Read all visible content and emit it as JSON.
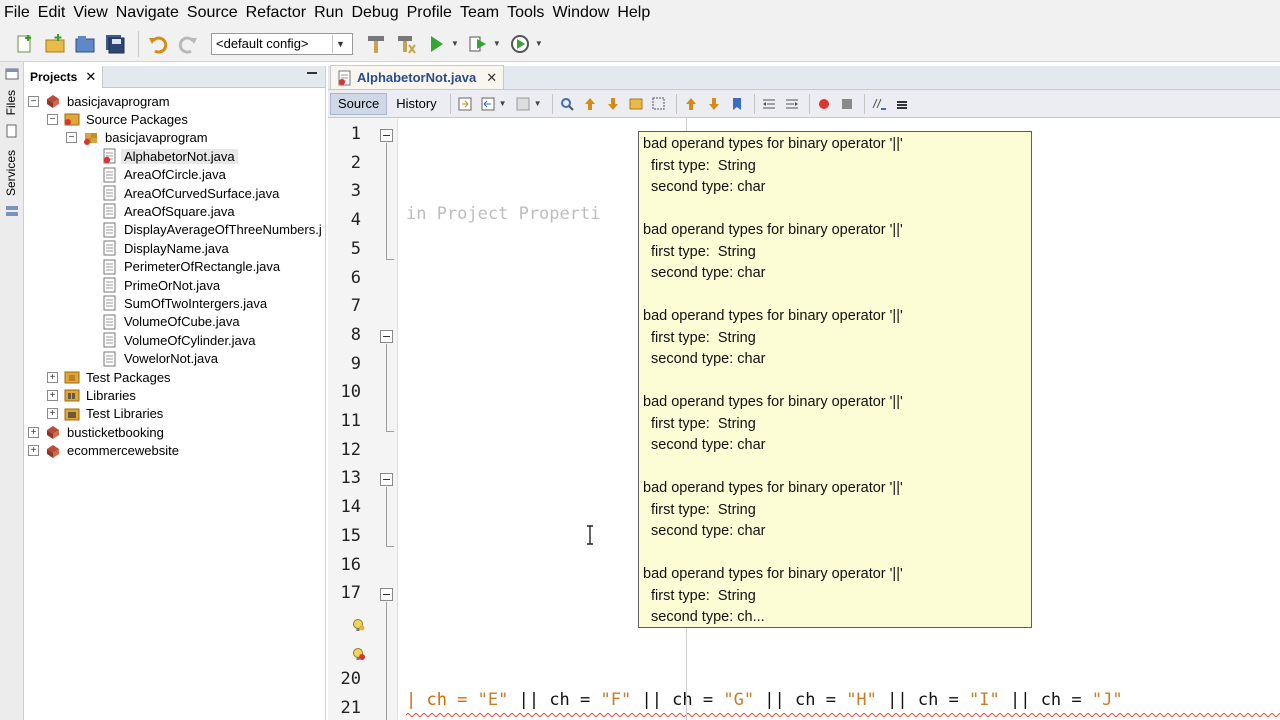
{
  "menu": [
    "File",
    "Edit",
    "View",
    "Navigate",
    "Source",
    "Refactor",
    "Run",
    "Debug",
    "Profile",
    "Team",
    "Tools",
    "Window",
    "Help"
  ],
  "toolbar": {
    "config_value": "<default config>"
  },
  "side_strip": {
    "files_label": "Files",
    "services_label": "Services"
  },
  "projects": {
    "tab_label": "Projects",
    "tree": [
      {
        "label": "basicjavaprogram",
        "depth": 0,
        "expander": "−",
        "icon": "project-icon"
      },
      {
        "label": "Source Packages",
        "depth": 1,
        "expander": "−",
        "icon": "source-packages-icon"
      },
      {
        "label": "basicjavaprogram",
        "depth": 2,
        "expander": "−",
        "icon": "package-icon"
      },
      {
        "label": "AlphabetorNot.java",
        "depth": 3,
        "icon": "java-file-error-icon",
        "selected": true
      },
      {
        "label": "AreaOfCircle.java",
        "depth": 3,
        "icon": "java-file-icon"
      },
      {
        "label": "AreaOfCurvedSurface.java",
        "depth": 3,
        "icon": "java-file-icon"
      },
      {
        "label": "AreaOfSquare.java",
        "depth": 3,
        "icon": "java-file-icon"
      },
      {
        "label": "DisplayAverageOfThreeNumbers.j",
        "depth": 3,
        "icon": "java-file-icon"
      },
      {
        "label": "DisplayName.java",
        "depth": 3,
        "icon": "java-file-icon"
      },
      {
        "label": "PerimeterOfRectangle.java",
        "depth": 3,
        "icon": "java-file-icon"
      },
      {
        "label": "PrimeOrNot.java",
        "depth": 3,
        "icon": "java-file-icon"
      },
      {
        "label": "SumOfTwoIntergers.java",
        "depth": 3,
        "icon": "java-file-icon"
      },
      {
        "label": "VolumeOfCube.java",
        "depth": 3,
        "icon": "java-file-icon"
      },
      {
        "label": "VolumeOfCylinder.java",
        "depth": 3,
        "icon": "java-file-icon"
      },
      {
        "label": "VowelorNot.java",
        "depth": 3,
        "icon": "java-file-icon"
      },
      {
        "label": "Test Packages",
        "depth": 1,
        "expander": "+",
        "icon": "test-packages-icon"
      },
      {
        "label": "Libraries",
        "depth": 1,
        "expander": "+",
        "icon": "libraries-icon"
      },
      {
        "label": "Test Libraries",
        "depth": 1,
        "expander": "+",
        "icon": "test-libraries-icon"
      },
      {
        "label": "busticketbooking",
        "depth": 0,
        "expander": "+",
        "icon": "project-icon"
      },
      {
        "label": "ecommercewebsite",
        "depth": 0,
        "expander": "+",
        "icon": "project-icon"
      }
    ]
  },
  "editor": {
    "file_tab": "AlphabetorNot.java",
    "source_tab": "Source",
    "history_tab": "History",
    "line_numbers": [
      "1",
      "2",
      "3",
      "4",
      "5",
      "6",
      "7",
      "8",
      "9",
      "10",
      "11",
      "12",
      "13",
      "14",
      "15",
      "16",
      "17",
      "20",
      "21"
    ],
    "ghost_text": "in Project Properti",
    "code_line": {
      "prefix": "| ch = ",
      "parts": [
        {
          "str": "\"E\"",
          "sep": " || ch = "
        },
        {
          "str": "\"F\"",
          "sep": " || ch = "
        },
        {
          "str": "\"G\"",
          "sep": " || ch = "
        },
        {
          "str": "\"H\"",
          "sep": " || ch = "
        },
        {
          "str": "\"I\"",
          "sep": " || ch = "
        },
        {
          "str": "\"J\"",
          "sep": ""
        }
      ]
    }
  },
  "tooltip": {
    "blocks": [
      {
        "title": "bad operand types for binary operator '||'",
        "first": "first type:  String",
        "second": "second type: char"
      },
      {
        "title": "bad operand types for binary operator '||'",
        "first": "first type:  String",
        "second": "second type: char"
      },
      {
        "title": "bad operand types for binary operator '||'",
        "first": "first type:  String",
        "second": "second type: char"
      },
      {
        "title": "bad operand types for binary operator '||'",
        "first": "first type:  String",
        "second": "second type: char"
      },
      {
        "title": "bad operand types for binary operator '||'",
        "first": "first type:  String",
        "second": "second type: char"
      },
      {
        "title": "bad operand types for binary operator '||'",
        "first": "first type:  String",
        "second": "second type: ch..."
      }
    ]
  }
}
